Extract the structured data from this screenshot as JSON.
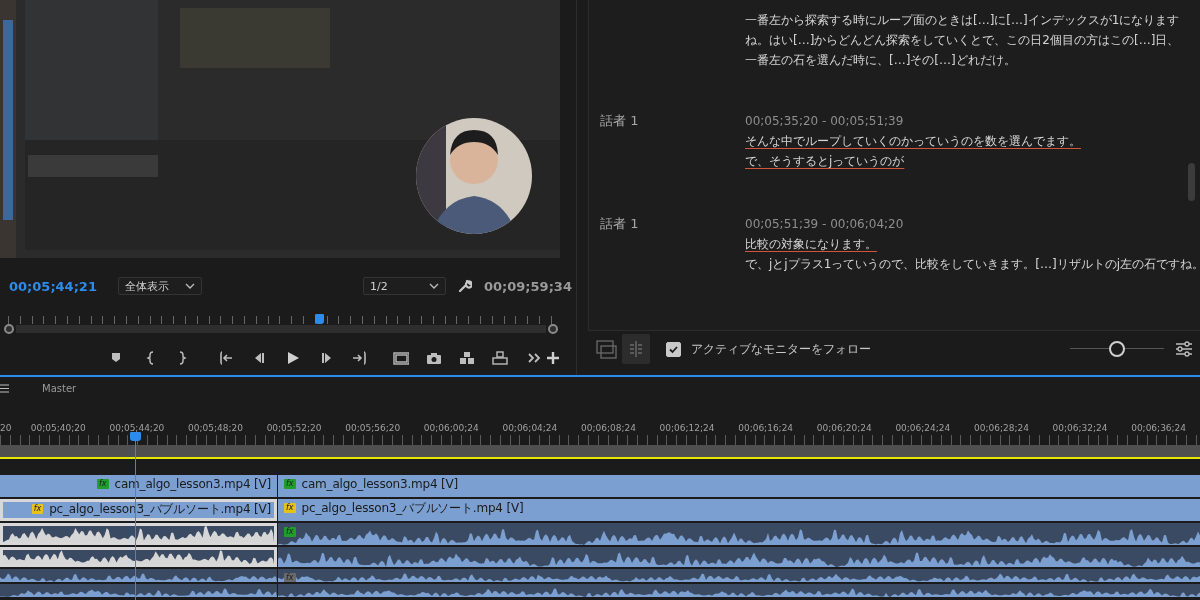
{
  "program_monitor": {
    "current_timecode": "00;05;44;21",
    "fit_dropdown": "全体表示",
    "resolution_dropdown": "1/2",
    "duration": "00;09;59;34",
    "playhead": {
      "level": 0.57
    }
  },
  "transcript": {
    "intro_text": "一番左から探索する時にループ面のときは[…]に[…]インデックスが1になりますね。はい[…]からどんどん探索をしていくとで、この日2個目の方はこの[…]日、一番左の石を選んだ時に、[…]その[…]どれだけ。",
    "entries": [
      {
        "speaker": "話者 1",
        "timecode": "00;05;35;20 - 00;05;51;39",
        "lines": [
          {
            "text": "そんな中でループしていくのかっていうのを数を選んでます。",
            "underlined": true
          },
          {
            "text": "で、そうするとjっていうのが",
            "underlined": true
          }
        ]
      },
      {
        "speaker": "話者 1",
        "timecode": "00;05;51;39 - 00;06;04;20",
        "lines": [
          {
            "text": "比較の対象になります。",
            "underlined": true
          },
          {
            "text": "で、jとjプラス1っていうので、比較をしていきます。[…]リザルトのj左の石ですね。",
            "underlined": false
          }
        ]
      }
    ]
  },
  "transcript_footer": {
    "follow_active_monitor": {
      "label": "アクティブなモニターをフォロー",
      "checked": true
    },
    "zoom": {
      "level": 0.5
    }
  },
  "timeline": {
    "sequence_label": "Master",
    "ruler": [
      "20",
      "00;05;40;20",
      "00;05;44;20",
      "00;05;48;20",
      "00;05;52;20",
      "00;05;56;20",
      "00;06;00;24",
      "00;06;04;24",
      "00;06;08;24",
      "00;06;12;24",
      "00;06;16;24",
      "00;06;20;24",
      "00;06;24;24",
      "00;06;28;24",
      "00;06;32;24",
      "00;06;36;24"
    ],
    "video_tracks": [
      {
        "clips": [
          {
            "name": "cam_algo_lesson3.mp4 [V]",
            "selected": false,
            "badge": {
              "label": "fx",
              "color": "#1f9e2a"
            }
          },
          {
            "name": "cam_algo_lesson3.mp4 [V]",
            "selected": false,
            "badge": {
              "label": "fx",
              "color": "#1f9e2a"
            }
          }
        ]
      },
      {
        "clips": [
          {
            "name": "pc_algo_lesson3_バブルソート.mp4 [V]",
            "selected": true,
            "badge": {
              "label": "fx",
              "color": "#e8c21a"
            }
          },
          {
            "name": "pc_algo_lesson3_バブルソート.mp4 [V]",
            "selected": false,
            "badge": {
              "label": "fx",
              "color": "#e8c21a"
            }
          }
        ]
      }
    ],
    "audio_tracks": [
      {
        "clips": [
          {
            "selected": true
          },
          {
            "selected": false,
            "badge": {
              "label": "fx",
              "color": "#1f9e2a"
            }
          }
        ]
      },
      {
        "clips": [
          {
            "selected": true
          },
          {
            "selected": false
          }
        ]
      },
      {
        "clips": [
          {
            "selected": false
          },
          {
            "selected": false,
            "badge": {
              "label": "fx",
              "color": "#6a6a6a"
            }
          }
        ]
      },
      {
        "clips": [
          {
            "selected": false
          },
          {
            "selected": false
          }
        ]
      }
    ]
  }
}
